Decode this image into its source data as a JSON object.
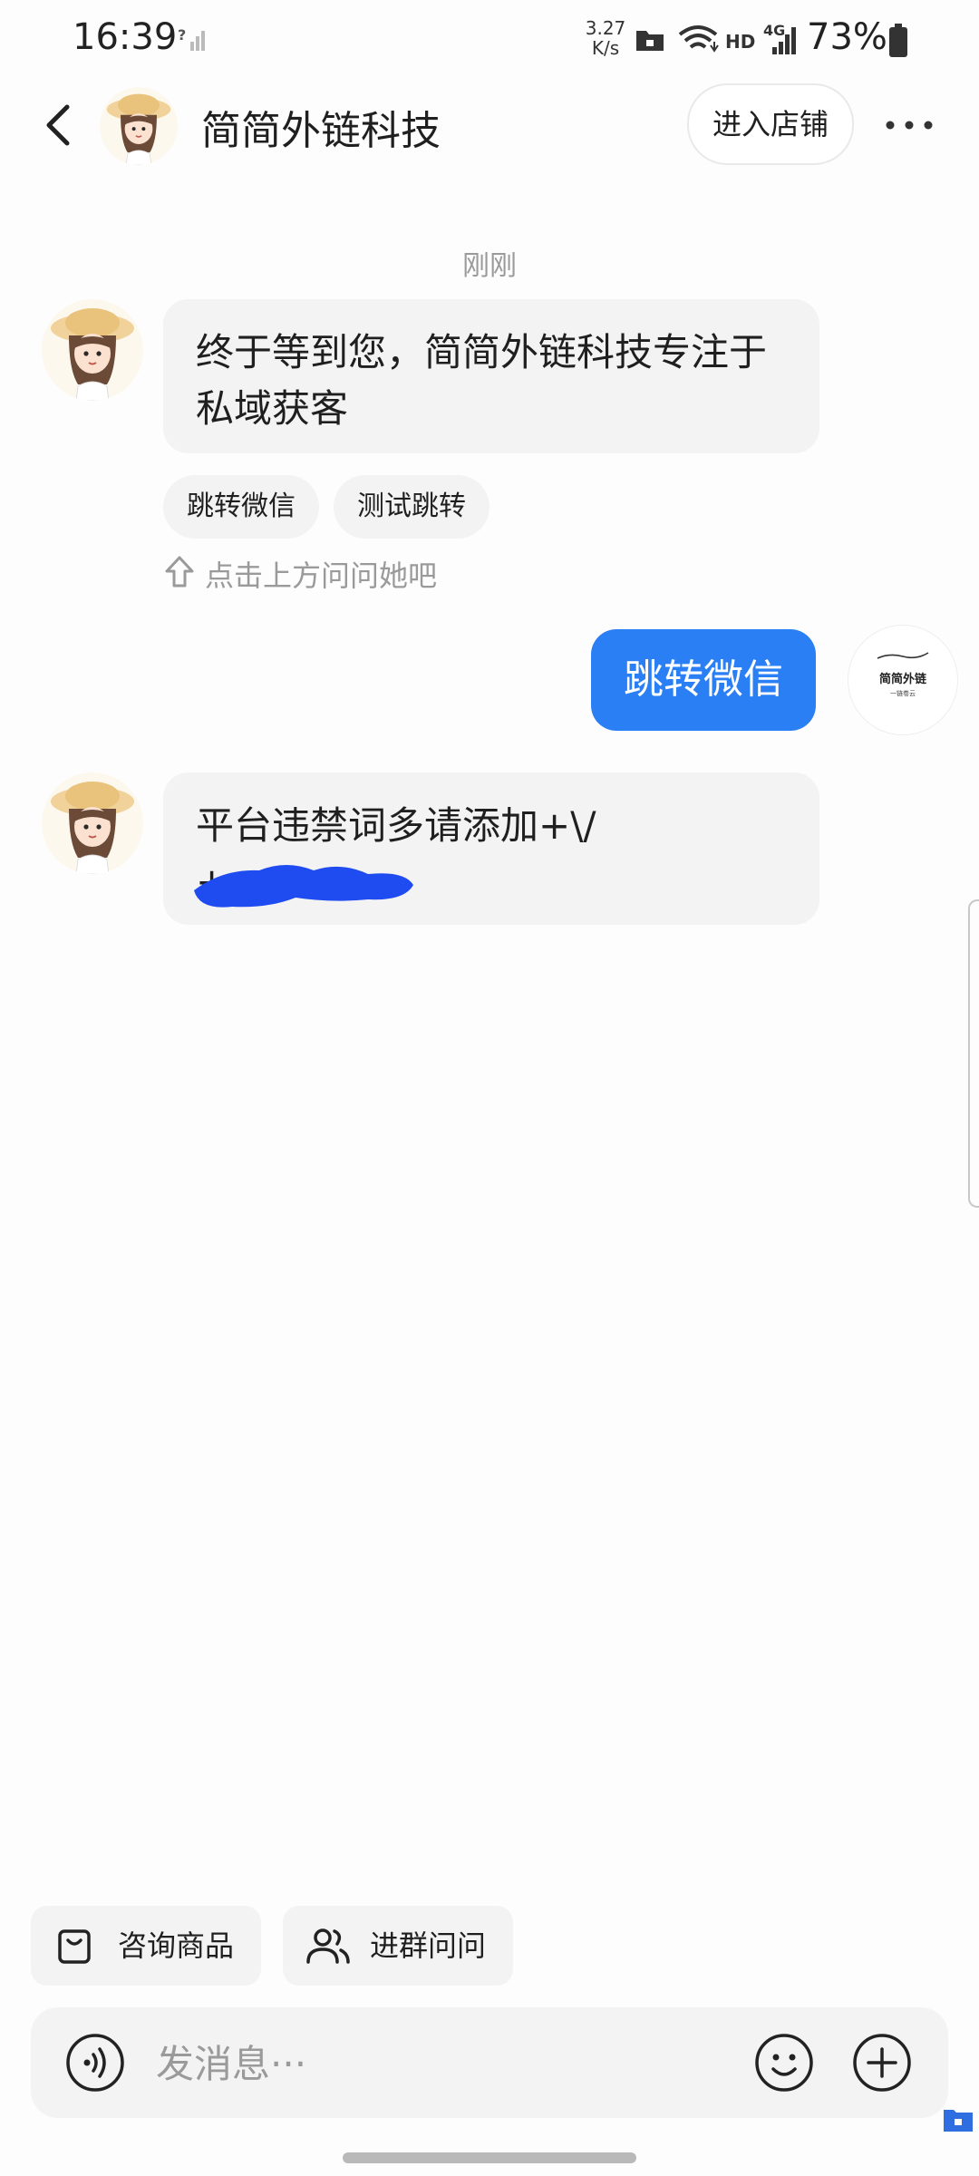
{
  "status_bar": {
    "time": "16:39",
    "net_speed_value": "3.27",
    "net_speed_unit": "K/s",
    "hd_label": "HD",
    "network_type": "4G",
    "battery": "73%"
  },
  "header": {
    "shop_name": "简简外链科技",
    "enter_store_label": "进入店铺"
  },
  "chat": {
    "timestamp": "刚刚",
    "messages": [
      {
        "from": "shop",
        "text": "终于等到您，简简外链科技专注于私域获客"
      },
      {
        "from": "user",
        "text": "跳转微信"
      },
      {
        "from": "shop",
        "text_line1": "平台违禁词多请添加+\\/",
        "text_line2": "+"
      }
    ],
    "suggestions": [
      "跳转微信",
      "测试跳转"
    ],
    "hint": "点击上方问问她吧",
    "user_avatar_text": "简简外链",
    "user_avatar_subtext": "一链卷云"
  },
  "quick_actions": [
    {
      "label": "咨询商品",
      "icon": "bag-icon"
    },
    {
      "label": "进群问问",
      "icon": "group-icon"
    }
  ],
  "input": {
    "placeholder": "发消息···"
  },
  "colors": {
    "accent": "#2b7ff5",
    "bubble": "#f3f3f3",
    "redaction": "#1f4cf0"
  }
}
